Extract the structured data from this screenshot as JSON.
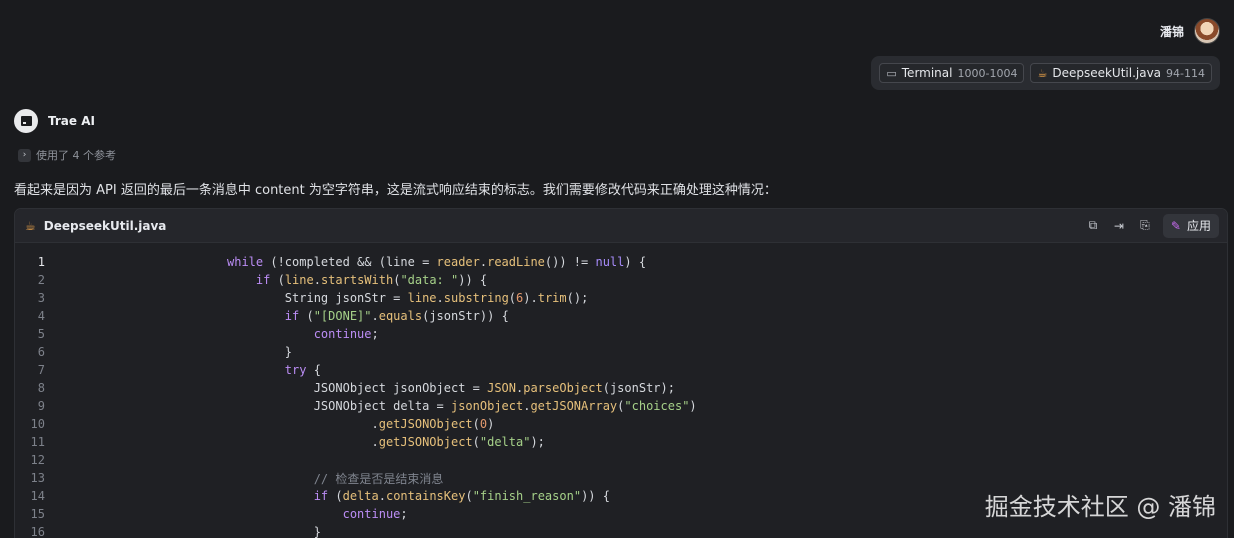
{
  "user": {
    "name": "潘锦"
  },
  "context_chips": [
    {
      "icon": "terminal-icon",
      "label": "Terminal",
      "range": "1000-1004"
    },
    {
      "icon": "java-file-icon",
      "label": "DeepseekUtil.java",
      "range": "94-114"
    }
  ],
  "assistant": {
    "name": "Trae AI",
    "refs_label": "使用了 4 个参考",
    "answer": "看起来是因为 API 返回的最后一条消息中 content 为空字符串，这是流式响应结束的标志。我们需要修改代码来正确处理这种情况："
  },
  "code_block": {
    "filename": "DeepseekUtil.java",
    "apply_label": "应用",
    "lines": [
      {
        "n": "1",
        "text": "while (!completed && (line = reader.readLine()) != null) {"
      },
      {
        "n": "2",
        "text": "    if (line.startsWith(\"data: \")) {"
      },
      {
        "n": "3",
        "text": "        String jsonStr = line.substring(6).trim();"
      },
      {
        "n": "4",
        "text": "        if (\"[DONE]\".equals(jsonStr)) {"
      },
      {
        "n": "5",
        "text": "            continue;"
      },
      {
        "n": "6",
        "text": "        }"
      },
      {
        "n": "7",
        "text": "        try {"
      },
      {
        "n": "8",
        "text": "            JSONObject jsonObject = JSON.parseObject(jsonStr);"
      },
      {
        "n": "9",
        "text": "            JSONObject delta = jsonObject.getJSONArray(\"choices\")"
      },
      {
        "n": "10",
        "text": "                    .getJSONObject(0)"
      },
      {
        "n": "11",
        "text": "                    .getJSONObject(\"delta\");"
      },
      {
        "n": "12",
        "text": ""
      },
      {
        "n": "13",
        "text": "            // 检查是否是结束消息"
      },
      {
        "n": "14",
        "text": "            if (delta.containsKey(\"finish_reason\")) {"
      },
      {
        "n": "15",
        "text": "                continue;"
      },
      {
        "n": "16",
        "text": "            }"
      }
    ]
  },
  "watermark": "掘金技术社区 @ 潘锦"
}
